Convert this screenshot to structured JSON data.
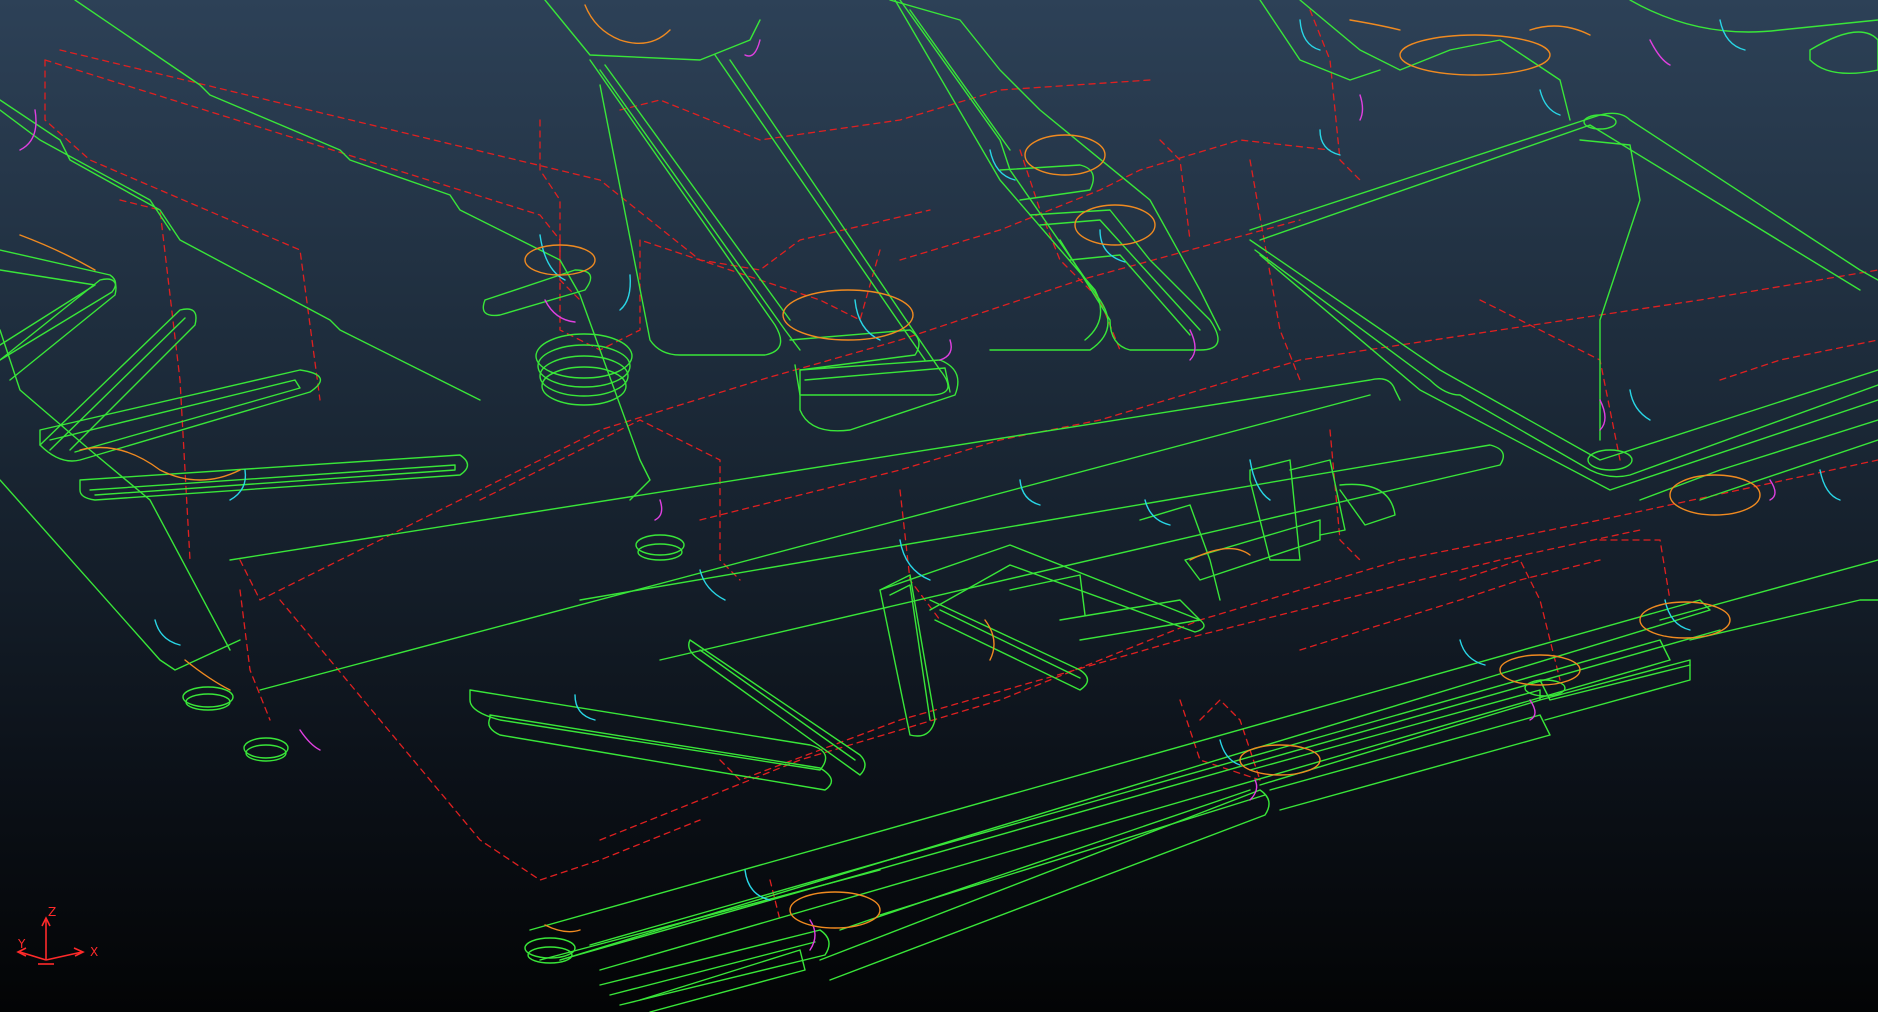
{
  "viewport": {
    "background_top": "#2d4157",
    "background_bottom": "#030405"
  },
  "colors": {
    "toolpath_feed": "#39e639",
    "toolpath_rapid": "#e02020",
    "lead_in": "#29d6e6",
    "lead_out": "#e040e0",
    "link_arc": "#f08a20",
    "triad_axis": "#ff2a2a"
  },
  "triad": {
    "x_label": "X",
    "y_label": "Y",
    "z_label": "Z"
  }
}
